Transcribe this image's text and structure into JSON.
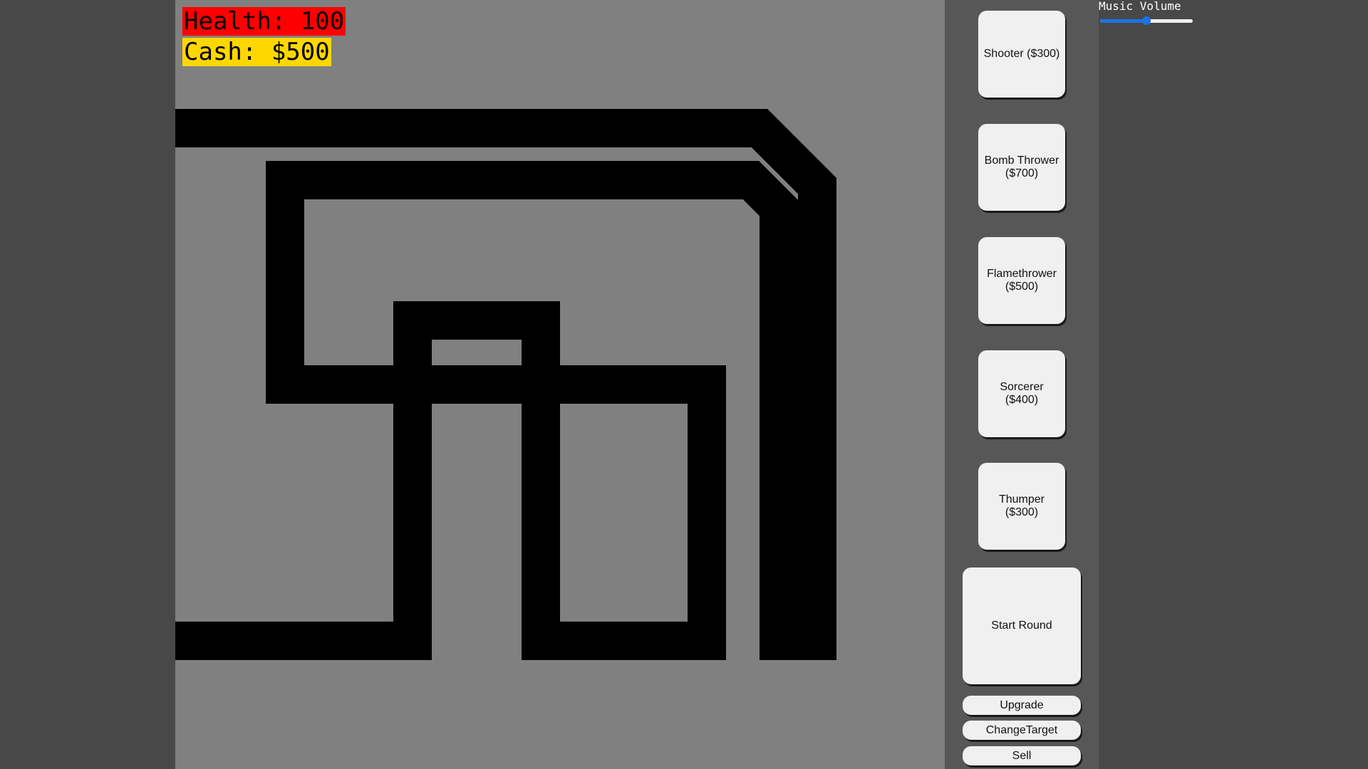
{
  "hud": {
    "health_text": "Health: 100",
    "cash_text": "Cash: $500",
    "health_bg": "#ff0000",
    "cash_bg": "#ffd700"
  },
  "towers": [
    {
      "label": "Shooter ($300)"
    },
    {
      "label": "Bomb Thrower\n($700)"
    },
    {
      "label": "Flamethrower\n($500)"
    },
    {
      "label": "Sorcerer\n($400)"
    },
    {
      "label": "Thumper\n($300)"
    }
  ],
  "controls": {
    "start_round": "Start Round",
    "upgrade": "Upgrade",
    "change_target": "ChangeTarget",
    "sell": "Sell"
  },
  "volume": {
    "label": "Music Volume",
    "level": 0.5,
    "accent": "#1a73e8"
  },
  "colors": {
    "background": "#484848",
    "map": "#808080",
    "panel": "#575757",
    "path": "#000000"
  }
}
